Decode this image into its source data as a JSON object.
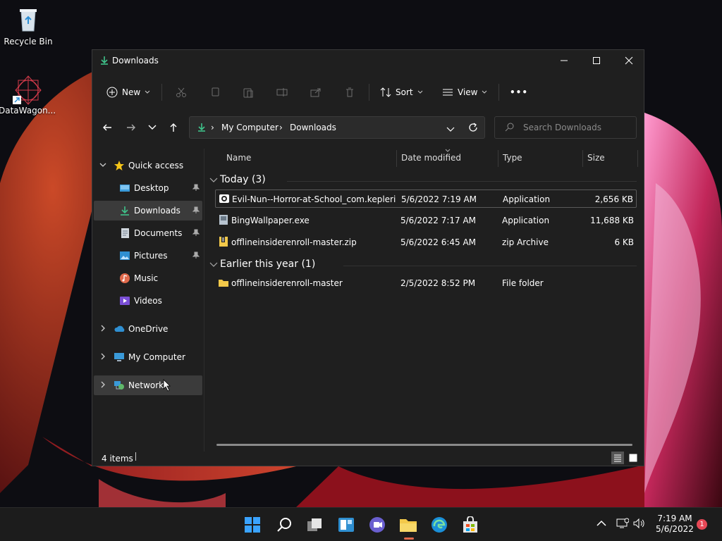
{
  "desktop": {
    "icons": [
      {
        "label": "Recycle Bin",
        "icon": "recycle-bin-icon"
      },
      {
        "label": "DataWagon...",
        "icon": "datawagon-shortcut-icon"
      }
    ]
  },
  "window": {
    "title": "Downloads",
    "controls": {
      "minimize": "minimize-icon",
      "maximize": "maximize-icon",
      "close": "close-icon"
    }
  },
  "commandbar": {
    "new_label": "New",
    "sort_label": "Sort",
    "view_label": "View",
    "more_label": "•••"
  },
  "address": {
    "crumbs": [
      "My Computer",
      "Downloads"
    ],
    "separator": "›",
    "search_placeholder": "Search Downloads"
  },
  "sidebar": {
    "quick_access": "Quick access",
    "items": [
      {
        "label": "Desktop"
      },
      {
        "label": "Downloads"
      },
      {
        "label": "Documents"
      },
      {
        "label": "Pictures"
      },
      {
        "label": "Music"
      },
      {
        "label": "Videos"
      }
    ],
    "onedrive": "OneDrive",
    "my_computer": "My Computer",
    "network": "Network"
  },
  "columns": {
    "name": "Name",
    "date": "Date modified",
    "type": "Type",
    "size": "Size"
  },
  "groups": [
    {
      "label": "Today (3)",
      "files": [
        {
          "name": "Evil-Nun--Horror-at-School_com.kepleri...",
          "date": "5/6/2022 7:19 AM",
          "type": "Application",
          "size": "2,656 KB"
        },
        {
          "name": "BingWallpaper.exe",
          "date": "5/6/2022 7:17 AM",
          "type": "Application",
          "size": "11,688 KB"
        },
        {
          "name": "offlineinsiderenroll-master.zip",
          "date": "5/6/2022 6:45 AM",
          "type": "zip Archive",
          "size": "6 KB"
        }
      ]
    },
    {
      "label": "Earlier this year (1)",
      "files": [
        {
          "name": "offlineinsiderenroll-master",
          "date": "2/5/2022 8:52 PM",
          "type": "File folder",
          "size": ""
        }
      ]
    }
  ],
  "status": {
    "items": "4 items"
  },
  "taskbar": {
    "time": "7:19 AM",
    "date": "5/6/2022",
    "notification_count": "1"
  },
  "colors": {
    "accent": "#0078d4",
    "window_bg": "#1f1f1f",
    "selected": "#3b3b3b",
    "badge": "#e74856"
  }
}
